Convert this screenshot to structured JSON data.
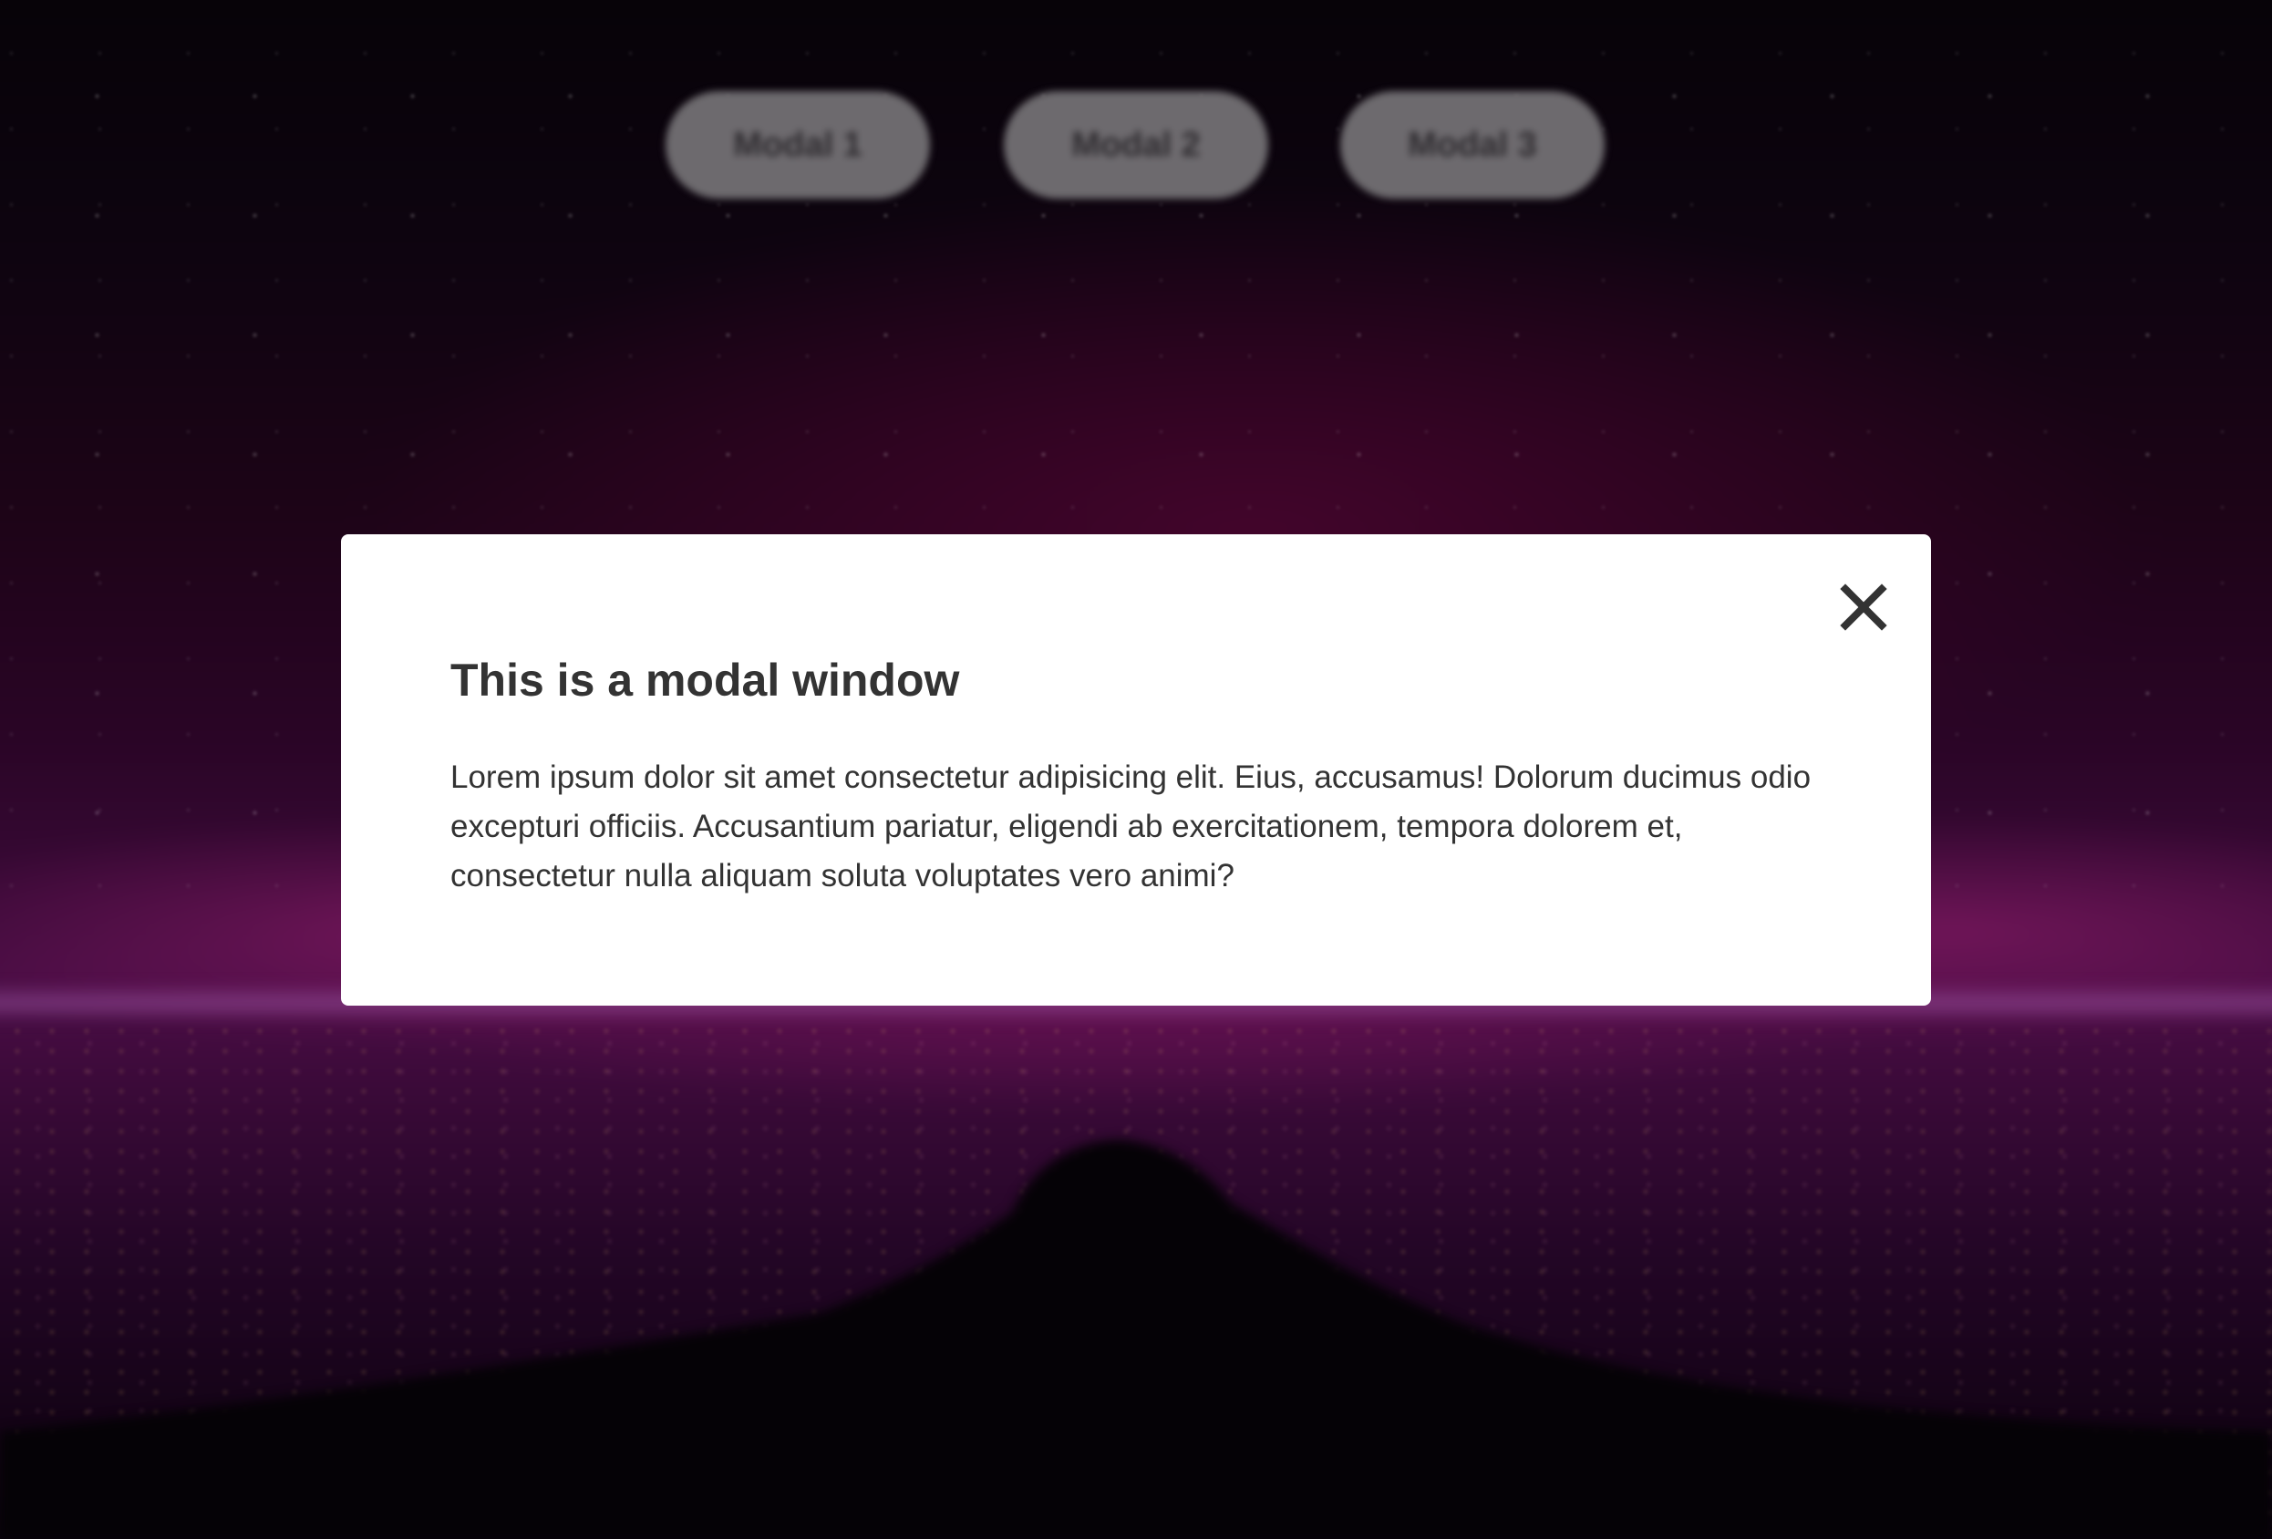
{
  "page": {
    "background_colors": {
      "sky_top": "#060307",
      "sky_glow": "#4a0d45",
      "ground": "#07030a"
    }
  },
  "buttons": [
    {
      "label": "Modal 1"
    },
    {
      "label": "Modal 2"
    },
    {
      "label": "Modal 3"
    }
  ],
  "modal": {
    "title": "This is a modal window",
    "body": "Lorem ipsum dolor sit amet consectetur adipisicing elit. Eius, accusamus! Dolorum ducimus odio excepturi officiis. Accusantium pariatur, eligendi ab exercitationem, tempora dolorem et, consectetur nulla aliquam soluta voluptates vero animi?",
    "close_icon": "close-icon",
    "background": "#ffffff",
    "text_color": "#333333"
  }
}
